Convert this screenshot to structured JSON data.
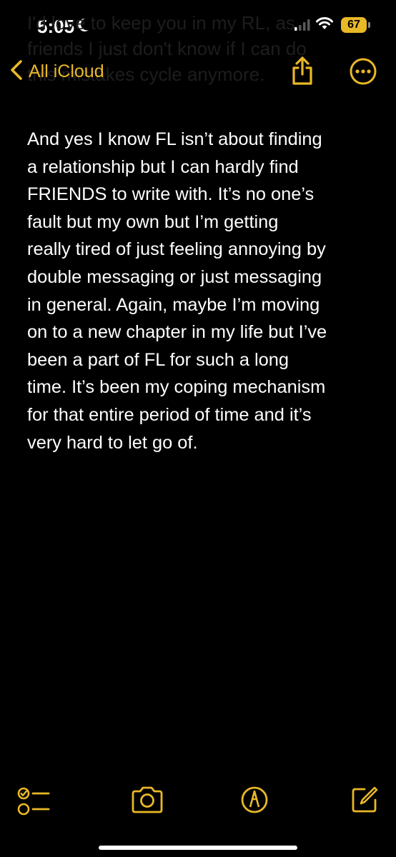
{
  "colors": {
    "accent": "#e9b827",
    "background": "#000000",
    "text": "#ffffff",
    "ghost": "#1d1d1d"
  },
  "status_bar": {
    "time": "5:05",
    "battery": "67"
  },
  "ghost_text": [
    "I'd love to keep you in my RL, as",
    "friends I just don't know if I can do",
    "this mistakes cycle anymore."
  ],
  "nav": {
    "back_label": "All iCloud",
    "share_icon": "share-icon",
    "more_icon": "ellipsis-circle-icon"
  },
  "note": {
    "lines": [
      "And yes I know FL isn’t about finding",
      "a relationship but I can hardly find",
      "FRIENDS to write with. It’s no one’s",
      "fault but my own but I’m getting",
      "really tired of just feeling annoying by",
      "double messaging or just messaging",
      "in general. Again, maybe I’m moving",
      "on to a new chapter in my life but I’ve",
      "been a part of FL for such a long",
      "time. It’s been my coping mechanism",
      "for that entire period of time and it’s",
      "very hard to let go of."
    ]
  },
  "toolbar": {
    "checklist_icon": "checklist-icon",
    "camera_icon": "camera-icon",
    "markup_icon": "markup-pen-icon",
    "compose_icon": "compose-icon"
  }
}
